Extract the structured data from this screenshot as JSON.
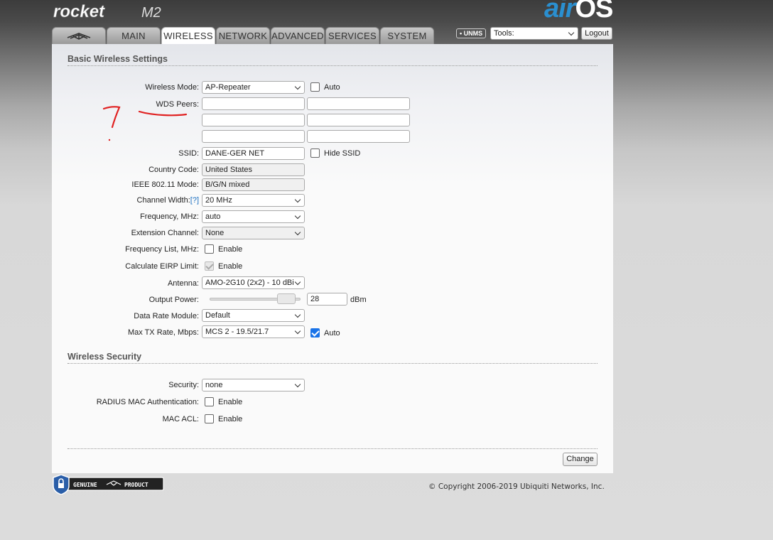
{
  "header": {
    "logo_text": "rocket",
    "logo_model": "M2",
    "brand_air": "air",
    "brand_os": "OS"
  },
  "tabs": [
    {
      "label": "",
      "icon": "ubiquiti-logo-icon"
    },
    {
      "label": "MAIN"
    },
    {
      "label": "WIRELESS",
      "active": true
    },
    {
      "label": "NETWORK"
    },
    {
      "label": "ADVANCED"
    },
    {
      "label": "SERVICES"
    },
    {
      "label": "SYSTEM"
    }
  ],
  "toolbar": {
    "unms_label": "UNMS",
    "tools_label": "Tools:",
    "logout_label": "Logout"
  },
  "basic": {
    "section_title": "Basic Wireless Settings",
    "wireless_mode": {
      "label": "Wireless Mode:",
      "value": "AP-Repeater",
      "auto_label": "Auto",
      "auto_checked": false
    },
    "wds_peers": {
      "label": "WDS Peers:",
      "values": [
        "",
        "",
        "",
        "",
        "",
        ""
      ]
    },
    "ssid": {
      "label": "SSID:",
      "value": "DANE-GER NET",
      "hide_label": "Hide SSID",
      "hide_checked": false
    },
    "country": {
      "label": "Country Code:",
      "value": "United States"
    },
    "ieee": {
      "label": "IEEE 802.11 Mode:",
      "value": "B/G/N mixed"
    },
    "channel_width": {
      "label": "Channel Width:",
      "help": "[?]",
      "value": "20 MHz"
    },
    "frequency": {
      "label": "Frequency, MHz:",
      "value": "auto"
    },
    "extension": {
      "label": "Extension Channel:",
      "value": "None"
    },
    "freq_list": {
      "label": "Frequency List, MHz:",
      "enable_label": "Enable",
      "checked": false
    },
    "eirp": {
      "label": "Calculate EIRP Limit:",
      "enable_label": "Enable",
      "checked": true,
      "disabled": true
    },
    "antenna": {
      "label": "Antenna:",
      "value": "AMO-2G10 (2x2) - 10 dBi"
    },
    "output_power": {
      "label": "Output Power:",
      "value": "28",
      "unit": "dBm",
      "slider_fraction": 0.93
    },
    "data_rate": {
      "label": "Data Rate Module:",
      "value": "Default"
    },
    "max_tx": {
      "label": "Max TX Rate, Mbps:",
      "value": "MCS 2 - 19.5/21.7",
      "auto_label": "Auto",
      "auto_checked": true
    }
  },
  "security": {
    "section_title": "Wireless Security",
    "security": {
      "label": "Security:",
      "value": "none"
    },
    "radius": {
      "label": "RADIUS MAC Authentication:",
      "enable_label": "Enable",
      "checked": false
    },
    "mac_acl": {
      "label": "MAC ACL:",
      "enable_label": "Enable",
      "checked": false
    }
  },
  "footer": {
    "change_label": "Change",
    "copyright": "© Copyright 2006-2019 Ubiquiti Networks, Inc.",
    "genuine_left": "GENUINE",
    "genuine_right": "PRODUCT"
  },
  "colors": {
    "accent_blue": "#2a8fd0",
    "checkbox_blue": "#1a73e8",
    "annotation_red": "#e02020"
  }
}
